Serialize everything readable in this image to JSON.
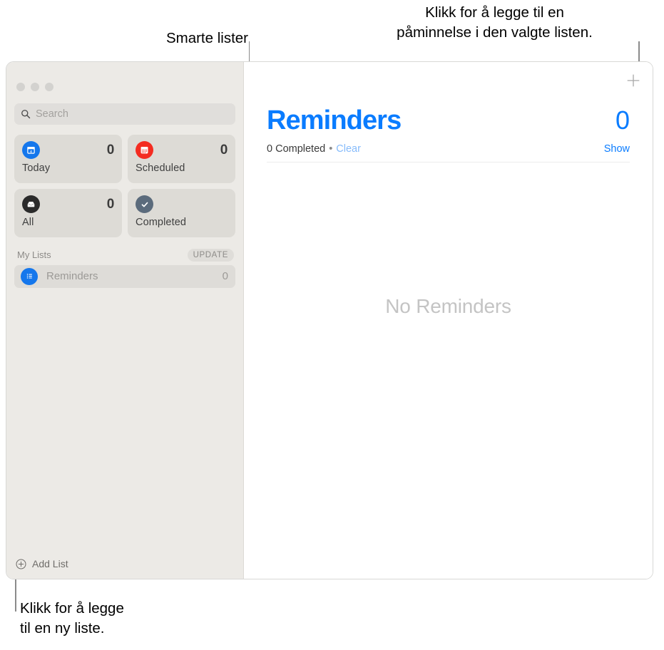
{
  "callouts": {
    "smart_lists": "Smarte lister",
    "add_reminder": "Klikk for å legge til en\npåminnelse i den valgte listen.",
    "add_list": "Klikk for å legge\ntil en ny liste."
  },
  "sidebar": {
    "search": {
      "placeholder": "Search",
      "value": "",
      "icon": "search-icon"
    },
    "smart_lists": [
      {
        "label": "Today",
        "count": "0",
        "icon": "calendar-today-icon",
        "color": "#1577ec"
      },
      {
        "label": "Scheduled",
        "count": "0",
        "icon": "calendar-grid-icon",
        "color": "#f42c21"
      },
      {
        "label": "All",
        "count": "0",
        "icon": "inbox-tray-icon",
        "color": "#2b2b2b"
      },
      {
        "label": "Completed",
        "count": "",
        "icon": "checkmark-circle-icon",
        "color": "#5b6b7c"
      }
    ],
    "my_lists": {
      "title": "My Lists",
      "badge": "UPDATE",
      "items": [
        {
          "label": "Reminders",
          "count": "0",
          "icon": "bulleted-list-icon",
          "color": "#1577ec"
        }
      ]
    },
    "add_list": {
      "label": "Add List",
      "icon": "plus-circle-icon"
    }
  },
  "content": {
    "add_reminder_icon": "plus-icon",
    "title": "Reminders",
    "total": "0",
    "completed_text": "0 Completed",
    "separator": "•",
    "clear_label": "Clear",
    "show_label": "Show",
    "empty_text": "No Reminders"
  },
  "colors": {
    "accent_blue": "#0a7cff",
    "list_blue": "#1577ec",
    "scheduled_red": "#f42c21",
    "all_black": "#2b2b2b",
    "completed_slate": "#5b6b7c",
    "sidebar_bg": "#eceae6",
    "card_bg": "#dddbd6"
  }
}
